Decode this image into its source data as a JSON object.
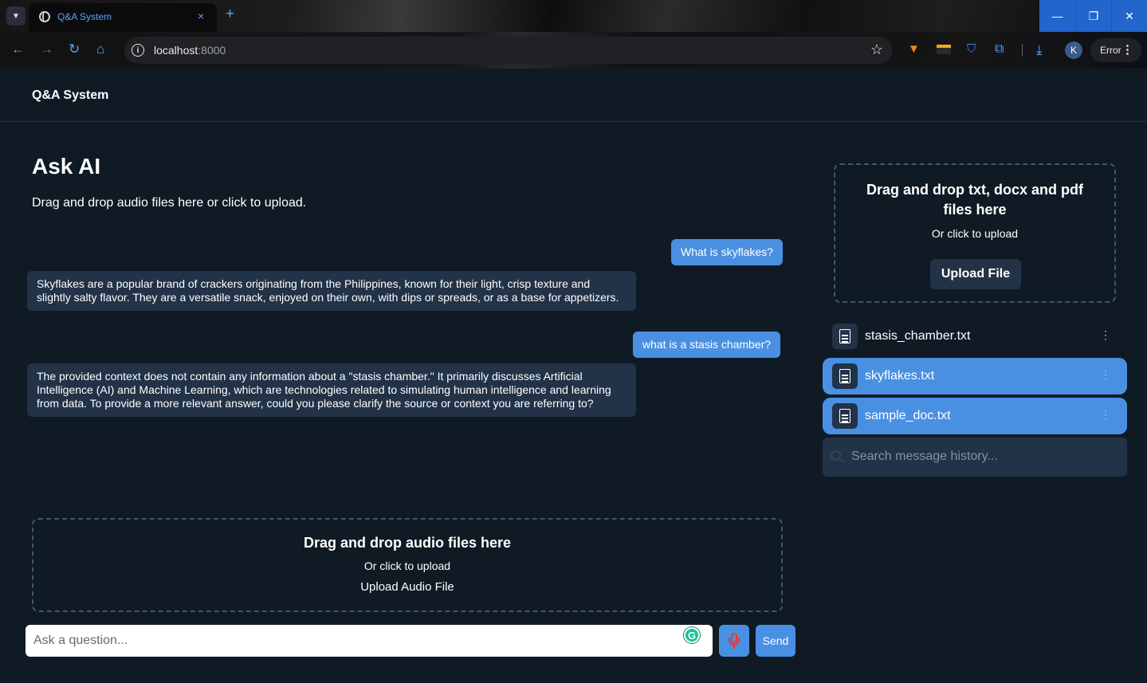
{
  "browser": {
    "tab_title": "Q&A System",
    "tab_close": "×",
    "new_tab": "+",
    "url_host": "localhost",
    "url_port": ":8000",
    "profile_initial": "K",
    "error_label": "Error",
    "window_controls": [
      "—",
      "❐",
      "✕"
    ]
  },
  "app": {
    "title": "Q&A System"
  },
  "main": {
    "heading": "Ask AI",
    "subheading": "Drag and drop audio files here or click to upload.",
    "messages": [
      {
        "role": "user",
        "text": "What is skyflakes?"
      },
      {
        "role": "ai",
        "text": "Skyflakes are a popular brand of crackers originating from the Philippines, known for their light, crisp texture and slightly salty flavor. They are a versatile snack, enjoyed on their own, with dips or spreads, or as a base for appetizers."
      },
      {
        "role": "user",
        "text": "what is a stasis chamber?"
      },
      {
        "role": "ai",
        "text": "The provided context does not contain any information about a \"stasis chamber.\" It primarily discusses Artificial Intelligence (AI) and Machine Learning, which are technologies related to simulating human intelligence and learning from data. To provide a more relevant answer, could you please clarify the source or context you are referring to?"
      }
    ],
    "audio_drop": {
      "title": "Drag and drop audio files here",
      "subtitle": "Or click to upload",
      "action": "Upload Audio File"
    },
    "question_input": {
      "placeholder": "Ask a question...",
      "value": ""
    },
    "send_label": "Send",
    "grammarly_glyph": "G"
  },
  "sidebar": {
    "doc_drop": {
      "title": "Drag and drop txt, docx and pdf files here",
      "subtitle": "Or click to upload",
      "button": "Upload File"
    },
    "files": [
      {
        "name": "stasis_chamber.txt",
        "active": false
      },
      {
        "name": "skyflakes.txt",
        "active": true
      },
      {
        "name": "sample_doc.txt",
        "active": true
      }
    ],
    "file_menu_glyph": "⋮",
    "history_search": {
      "placeholder": "Search message history...",
      "value": ""
    }
  },
  "colors": {
    "background": "#0f1a24",
    "accent": "#4a90e2",
    "panel": "#223247",
    "browser_accent": "#5ba1ff",
    "mic": "#e53935"
  },
  "icons": {
    "tab_favicon": "globe-icon",
    "back": "arrow-left-icon",
    "forward": "arrow-right-icon",
    "reload": "reload-icon",
    "home": "home-icon",
    "site_info": "info-icon",
    "bookmark": "star-icon",
    "extensions": [
      "fox-extension-icon",
      "dark-extension-icon",
      "shield-extension-icon",
      "puzzle-icon",
      "download-icon"
    ],
    "file": "document-icon",
    "mic": "microphone-icon",
    "search": "search-icon"
  }
}
